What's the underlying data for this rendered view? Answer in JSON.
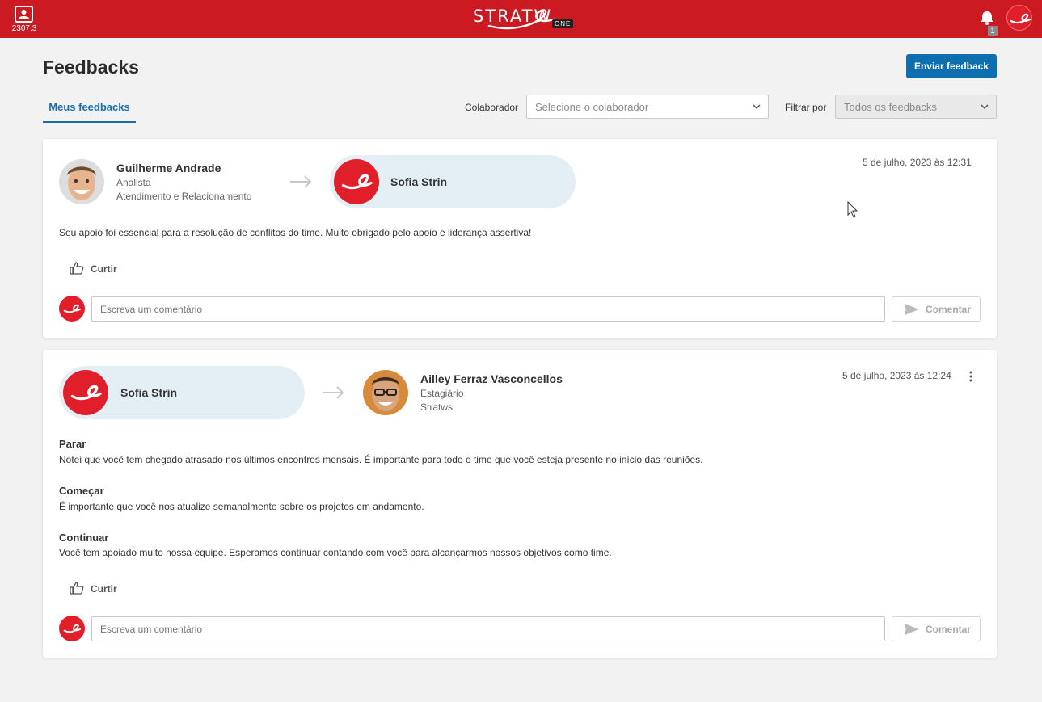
{
  "header": {
    "version": "2307.3",
    "logo_text": "STRATW",
    "logo_badge": "ONE",
    "notification_count": "1"
  },
  "page": {
    "title": "Feedbacks",
    "send_button": "Enviar feedback",
    "tab_label": "Meus feedbacks"
  },
  "filters": {
    "collaborator_label": "Colaborador",
    "collaborator_placeholder": "Selecione o colaborador",
    "filter_label": "Filtrar por",
    "filter_value": "Todos os feedbacks"
  },
  "feedbacks": [
    {
      "sender_name": "Guilherme Andrade",
      "sender_role": "Analista",
      "sender_dept": "Atendimento e Relacionamento",
      "receiver_name": "Sofia Strin",
      "date": "5 de julho, 2023 às 12:31",
      "message": "Seu apoio foi essencial para a resolução de conflitos do time. Muito obrigado pelo apoio e liderança assertiva!",
      "like_label": "Curtir",
      "comment_placeholder": "Escreva um comentário",
      "comment_button": "Comentar"
    },
    {
      "sender_name": "Sofia Strin",
      "receiver_name": "Ailley Ferraz Vasconcellos",
      "receiver_role": "Estagiário",
      "receiver_dept": "Stratws",
      "date": "5 de julho, 2023 às 12:24",
      "sections": [
        {
          "title": "Parar",
          "text": "Notei que você tem chegado atrasado nos últimos encontros mensais. É importante para todo o time que você esteja presente no início das reuniões."
        },
        {
          "title": "Começar",
          "text": "É importante que você nos atualize semanalmente sobre os projetos em andamento."
        },
        {
          "title": "Continuar",
          "text": "Você tem apoiado muito nossa equipe. Esperamos continuar contando com você para alcançarmos nossos objetivos como time."
        }
      ],
      "like_label": "Curtir",
      "comment_placeholder": "Escreva um comentário",
      "comment_button": "Comentar"
    }
  ],
  "colors": {
    "topbar": "#cc1a22",
    "primary": "#0d6fb0",
    "brand_avatar": "#e01f2b",
    "pill_bg": "#e4eff5"
  }
}
